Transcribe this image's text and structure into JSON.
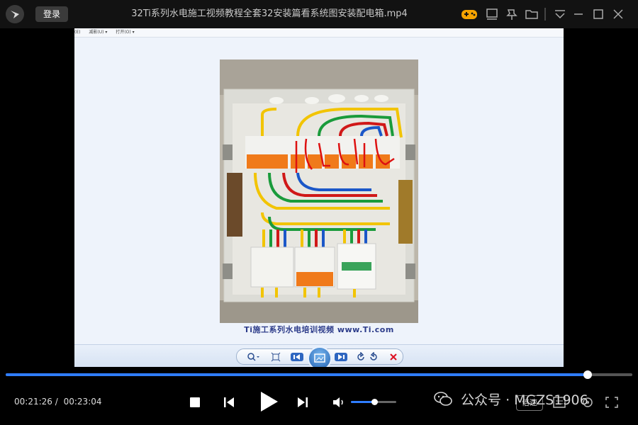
{
  "titlebar": {
    "login_label": "登录",
    "title": "32Ti系列水电施工视频教程全套32安装篇看系统图安装配电箱.mp4",
    "icons": [
      "game-icon",
      "screen-icon",
      "pin-icon",
      "folder-icon",
      "menu-icon",
      "minimize-icon",
      "maximize-icon",
      "close-icon"
    ]
  },
  "viewer": {
    "menu": [
      "(E)",
      "减影(U) ▾",
      "打开(O) ▾"
    ],
    "watermark": "Ti施工系列水电培训视频 www.Ti.com",
    "toolbar_icons": [
      "zoom-icon",
      "fit-icon",
      "prev-icon",
      "slideshow-icon",
      "next-icon",
      "rotate-left-icon",
      "rotate-right-icon",
      "delete-icon"
    ]
  },
  "player": {
    "current_time": "00:21:26",
    "separator": "/",
    "total_time": "00:23:04",
    "progress_fraction": 0.929,
    "volume_fraction": 0.52,
    "speed_label": "倍速",
    "overlay_text": "公众号 · MGZS1906",
    "colors": {
      "accent": "#2f7dff",
      "background": "#000000",
      "titlebar": "#121212"
    }
  }
}
